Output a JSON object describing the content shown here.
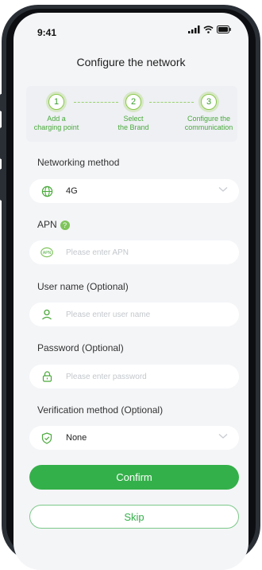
{
  "status_bar": {
    "time": "9:41"
  },
  "header": {
    "title": "Configure the network"
  },
  "stepper": {
    "steps": [
      {
        "number": "1",
        "label_line1": "Add a",
        "label_line2": "charging point"
      },
      {
        "number": "2",
        "label_line1": "Select",
        "label_line2": "the Brand"
      },
      {
        "number": "3",
        "label_line1": "Configure the",
        "label_line2": "communication"
      }
    ]
  },
  "networking": {
    "label": "Networking method",
    "value": "4G"
  },
  "apn": {
    "label": "APN",
    "help": "?",
    "placeholder": "Please enter APN",
    "icon_text": "APN"
  },
  "username": {
    "label": "User name (Optional)",
    "placeholder": "Please enter user name"
  },
  "password": {
    "label": "Password  (Optional)",
    "placeholder": "Please enter password"
  },
  "verification": {
    "label": "Verification method  (Optional)",
    "value": "None"
  },
  "actions": {
    "confirm": "Confirm",
    "skip": "Skip"
  },
  "colors": {
    "accent": "#34b04a",
    "step": "#4aa93b",
    "background": "#f4f5f7"
  }
}
